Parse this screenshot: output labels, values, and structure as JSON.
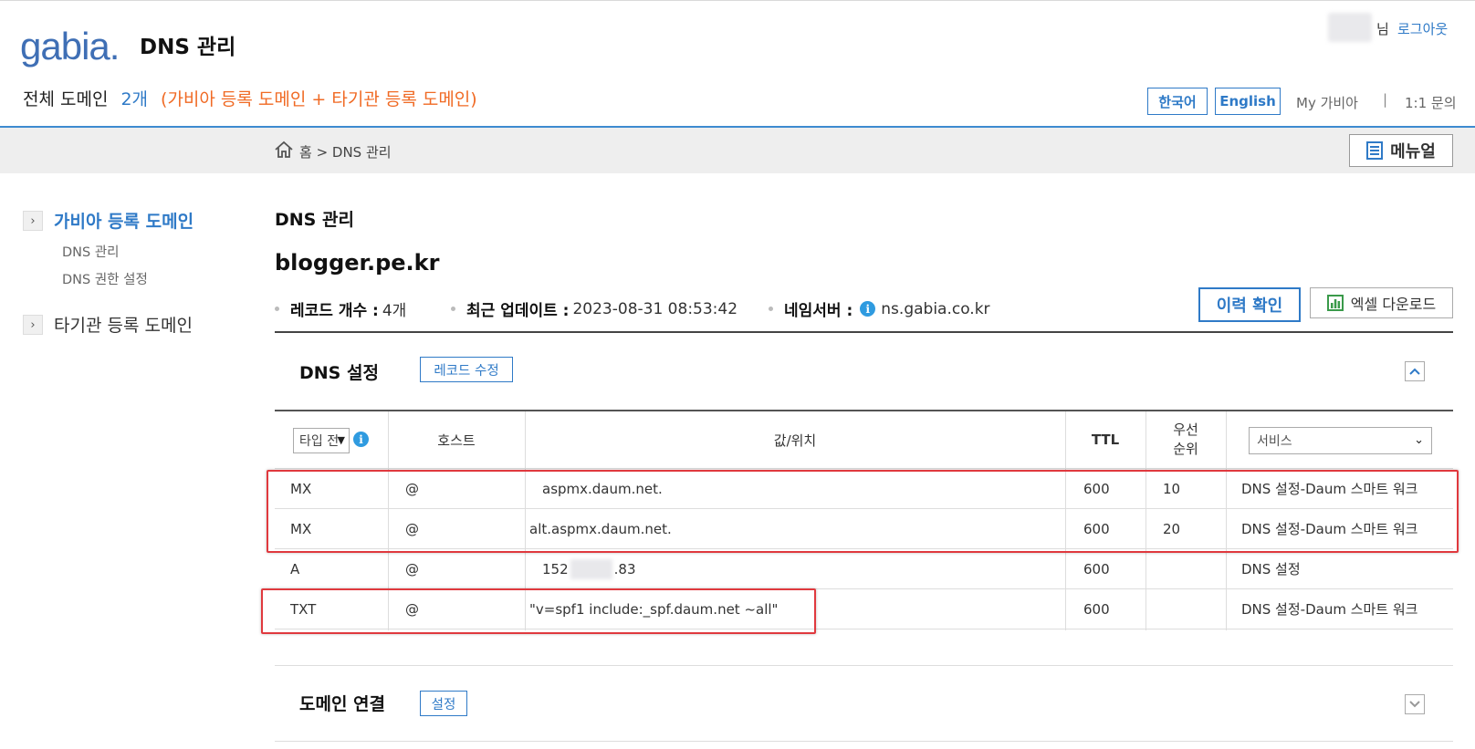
{
  "header": {
    "logo": "gabia.",
    "title": "DNS 관리",
    "user_suffix": "님",
    "logout": "로그아웃",
    "summary_label": "전체 도메인",
    "summary_count": "2개",
    "summary_note": "(가비아 등록 도메인 + 타기관 등록 도메인)",
    "lang_ko": "한국어",
    "lang_en": "English",
    "my_gabia": "My 가비아",
    "separator": "|",
    "inquiry": "1:1 문의"
  },
  "breadcrumb": {
    "text": "홈 > DNS 관리",
    "manual": "메뉴얼"
  },
  "sidebar": {
    "groups": [
      {
        "label": "가비아 등록 도메인",
        "active": true,
        "items": [
          "DNS 관리",
          "DNS 권한 설정"
        ]
      },
      {
        "label": "타기관 등록 도메인",
        "active": false,
        "items": []
      }
    ]
  },
  "content": {
    "page_heading": "DNS 관리",
    "domain": "blogger.pe.kr",
    "record_count_label": "레코드 개수 :",
    "record_count": "4개",
    "updated_label": "최근 업데이트 :",
    "updated_value": "2023-08-31 08:53:42",
    "ns_label": "네임서버 :",
    "ns_value": "ns.gabia.co.kr",
    "history_button": "이력 확인",
    "excel_button": "엑셀 다운로드"
  },
  "dns_section": {
    "title": "DNS 설정",
    "edit_button": "레코드 수정",
    "columns": {
      "type_select": "타입 전",
      "host": "호스트",
      "value": "값/위치",
      "ttl": "TTL",
      "priority_line1": "우선",
      "priority_line2": "순위",
      "service_select": "서비스"
    },
    "records": [
      {
        "type": "MX",
        "host": "@",
        "value": "aspmx.daum.net.",
        "ttl": "600",
        "priority": "10",
        "service": "DNS 설정-Daum 스마트 워크"
      },
      {
        "type": "MX",
        "host": "@",
        "value": "alt.aspmx.daum.net.",
        "ttl": "600",
        "priority": "20",
        "service": "DNS 설정-Daum 스마트 워크"
      },
      {
        "type": "A",
        "host": "@",
        "value_prefix": "152",
        "value_suffix": ".83",
        "ttl": "600",
        "priority": "",
        "service": "DNS 설정"
      },
      {
        "type": "TXT",
        "host": "@",
        "value": "\"v=spf1 include:_spf.daum.net ~all\"",
        "ttl": "600",
        "priority": "",
        "service": "DNS 설정-Daum 스마트 워크"
      }
    ]
  },
  "connect_section": {
    "title": "도메인 연결",
    "button": "설정"
  },
  "icons": {
    "home": "home-icon",
    "manual": "document-list-icon",
    "excel": "chart-icon",
    "info": "info-icon",
    "toggle_up": "chevron-up-icon",
    "toggle_down": "chevron-down-icon"
  },
  "colors": {
    "brand_blue": "#2f7ac7",
    "note_orange": "#f06a24",
    "highlight_red": "#e0393e"
  }
}
